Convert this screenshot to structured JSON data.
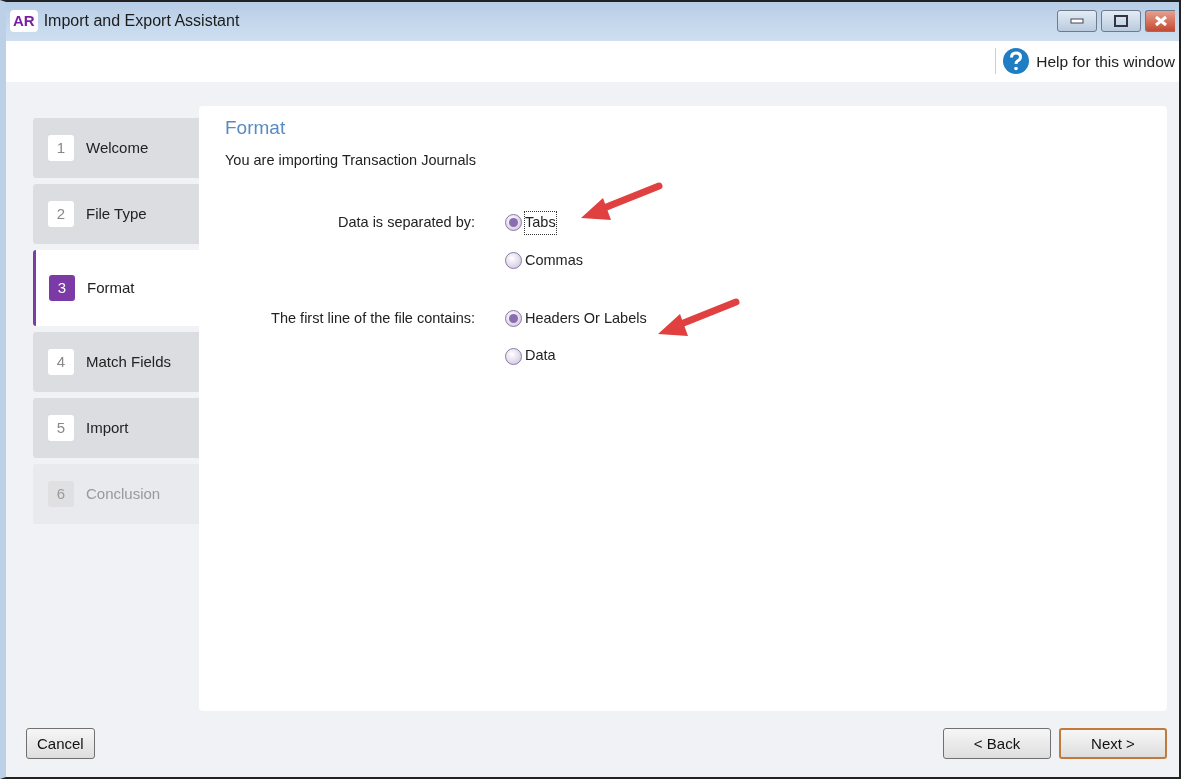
{
  "window": {
    "logo": "AR",
    "title": "Import and Export Assistant"
  },
  "toolbar": {
    "help": "Help for this window"
  },
  "steps": [
    {
      "number": "1",
      "label": "Welcome",
      "selected": false,
      "disabled": false
    },
    {
      "number": "2",
      "label": "File Type",
      "selected": false,
      "disabled": false
    },
    {
      "number": "3",
      "label": "Format",
      "selected": true,
      "disabled": false
    },
    {
      "number": "4",
      "label": "Match Fields",
      "selected": false,
      "disabled": false
    },
    {
      "number": "5",
      "label": "Import",
      "selected": false,
      "disabled": false
    },
    {
      "number": "6",
      "label": "Conclusion",
      "selected": false,
      "disabled": true
    }
  ],
  "panel": {
    "heading": "Format",
    "intro": "You are importing Transaction Journals",
    "groups": [
      {
        "label": "Data is separated by:",
        "options": [
          {
            "label": "Tabs",
            "selected": true,
            "focused": true
          },
          {
            "label": "Commas",
            "selected": false,
            "focused": false
          }
        ]
      },
      {
        "label": "The first line of the file contains:",
        "options": [
          {
            "label": "Headers Or Labels",
            "selected": true,
            "focused": false
          },
          {
            "label": "Data",
            "selected": false,
            "focused": false
          }
        ]
      }
    ]
  },
  "footer": {
    "cancel": "Cancel",
    "back": "< Back",
    "next": "Next >"
  }
}
